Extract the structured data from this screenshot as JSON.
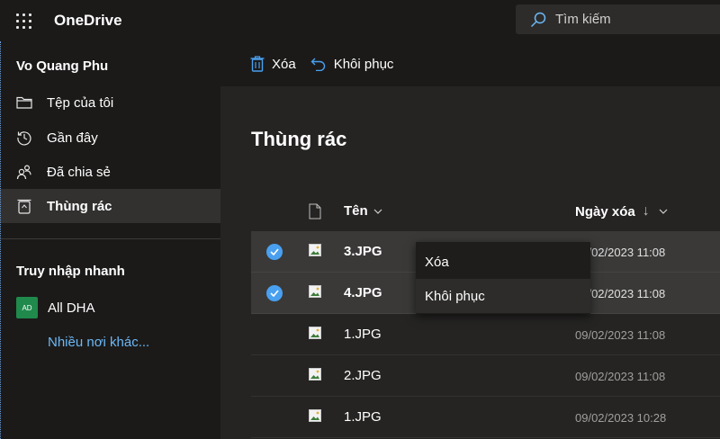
{
  "app": {
    "title": "OneDrive"
  },
  "search": {
    "placeholder": "Tìm kiếm"
  },
  "user": {
    "name": "Vo Quang Phu"
  },
  "nav": {
    "items": [
      {
        "label": "Tệp của tôi",
        "icon": "folder-icon"
      },
      {
        "label": "Gần đây",
        "icon": "history-icon"
      },
      {
        "label": "Đã chia sẻ",
        "icon": "people-icon"
      },
      {
        "label": "Thùng rác",
        "icon": "recycle-bin-icon",
        "selected": true
      }
    ]
  },
  "quick_access": {
    "title": "Truy nhập nhanh",
    "items": [
      {
        "badge": "AD",
        "label": "All DHA"
      }
    ],
    "more_link": "Nhiều nơi khác..."
  },
  "commandbar": {
    "delete_label": "Xóa",
    "restore_label": "Khôi phục"
  },
  "page": {
    "title": "Thùng rác"
  },
  "table": {
    "headers": {
      "name": "Tên",
      "date": "Ngày xóa",
      "sort_arrow": "↓"
    },
    "rows": [
      {
        "name": "3.JPG",
        "date": "09/02/2023 11:08",
        "selected": true
      },
      {
        "name": "4.JPG",
        "date": "09/02/2023 11:08",
        "selected": true
      },
      {
        "name": "1.JPG",
        "date": "09/02/2023 11:08",
        "selected": false
      },
      {
        "name": "2.JPG",
        "date": "09/02/2023 11:08",
        "selected": false
      },
      {
        "name": "1.JPG",
        "date": "09/02/2023 10:28",
        "selected": false
      }
    ]
  },
  "context_menu": {
    "items": [
      {
        "label": "Xóa"
      },
      {
        "label": "Khôi phục"
      }
    ]
  },
  "colors": {
    "accent": "#4aa0f0",
    "link": "#6cb8f6",
    "background": "#1b1a19",
    "content": "#252423"
  }
}
